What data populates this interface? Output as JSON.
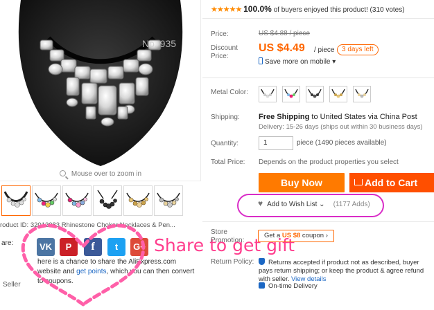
{
  "gallery": {
    "main_image_alt": "necklace-photo",
    "watermark": "No. 935",
    "zoom_hint": "Mouse over to zoom in",
    "thumbnails": [
      "thumb-1",
      "thumb-2",
      "thumb-3",
      "thumb-4",
      "thumb-5",
      "thumb-6"
    ],
    "product_id": "roduct ID: 32012083  Rhinestone Choker Necklaces & Pen..."
  },
  "share": {
    "label": "are:",
    "networks": [
      "VK",
      "P",
      "f",
      "t",
      "G+"
    ],
    "promo": "Share to get gift",
    "text_before": "here is a chance to share the AliExpress.com website and ",
    "text_link": "get points",
    "text_after": ", which you can then convert to coupons."
  },
  "seller": {
    "label": "Seller"
  },
  "rating": {
    "stars": "★★★★★",
    "percent": "100.0%",
    "text": "of buyers enjoyed this product! (310 votes)"
  },
  "pricing": {
    "price_label": "Price:",
    "old_price": "US $4.88 / piece",
    "discount_label_1": "Discount",
    "discount_label_2": "Price:",
    "price": "US $4.49",
    "per_piece": "/ piece",
    "days_left": "3 days left",
    "mobile": "Save more on mobile"
  },
  "options": {
    "metal_color_label": "Metal Color:",
    "swatch_count": 5
  },
  "shipping": {
    "label": "Shipping:",
    "free": "Free Shipping",
    "to": "to",
    "destination": "United States via China Post",
    "delivery": "Delivery: 15-26 days (ships out within 30 business days)"
  },
  "quantity": {
    "label": "Quantity:",
    "value": "1",
    "note": "piece (1490 pieces available)"
  },
  "total": {
    "label": "Total Price:",
    "note": "Depends on the product properties you select"
  },
  "actions": {
    "buy_now": "Buy Now",
    "add_to_cart": "Add to Cart",
    "wishlist": "Add to Wish List",
    "wishlist_count": "(1177 Adds)"
  },
  "store_promotion": {
    "label_1": "Store",
    "label_2": "Promotion:",
    "coupon_prefix": "Get a ",
    "coupon_value": "US $8",
    "coupon_suffix": " coupon"
  },
  "return_policy": {
    "label": "Return Policy:",
    "text": "Returns accepted if product not as described, buyer pays return shipping; or keep the product & agree refund with seller.",
    "link": "View details"
  },
  "delivery_badge": "On-time Delivery",
  "colors": {
    "accent": "#ff6600",
    "buy": "#ff7a00",
    "cart": "#ff4f00",
    "link": "#1b67c4",
    "promo": "#ff3d8d",
    "ellipse": "#d92cc7"
  }
}
